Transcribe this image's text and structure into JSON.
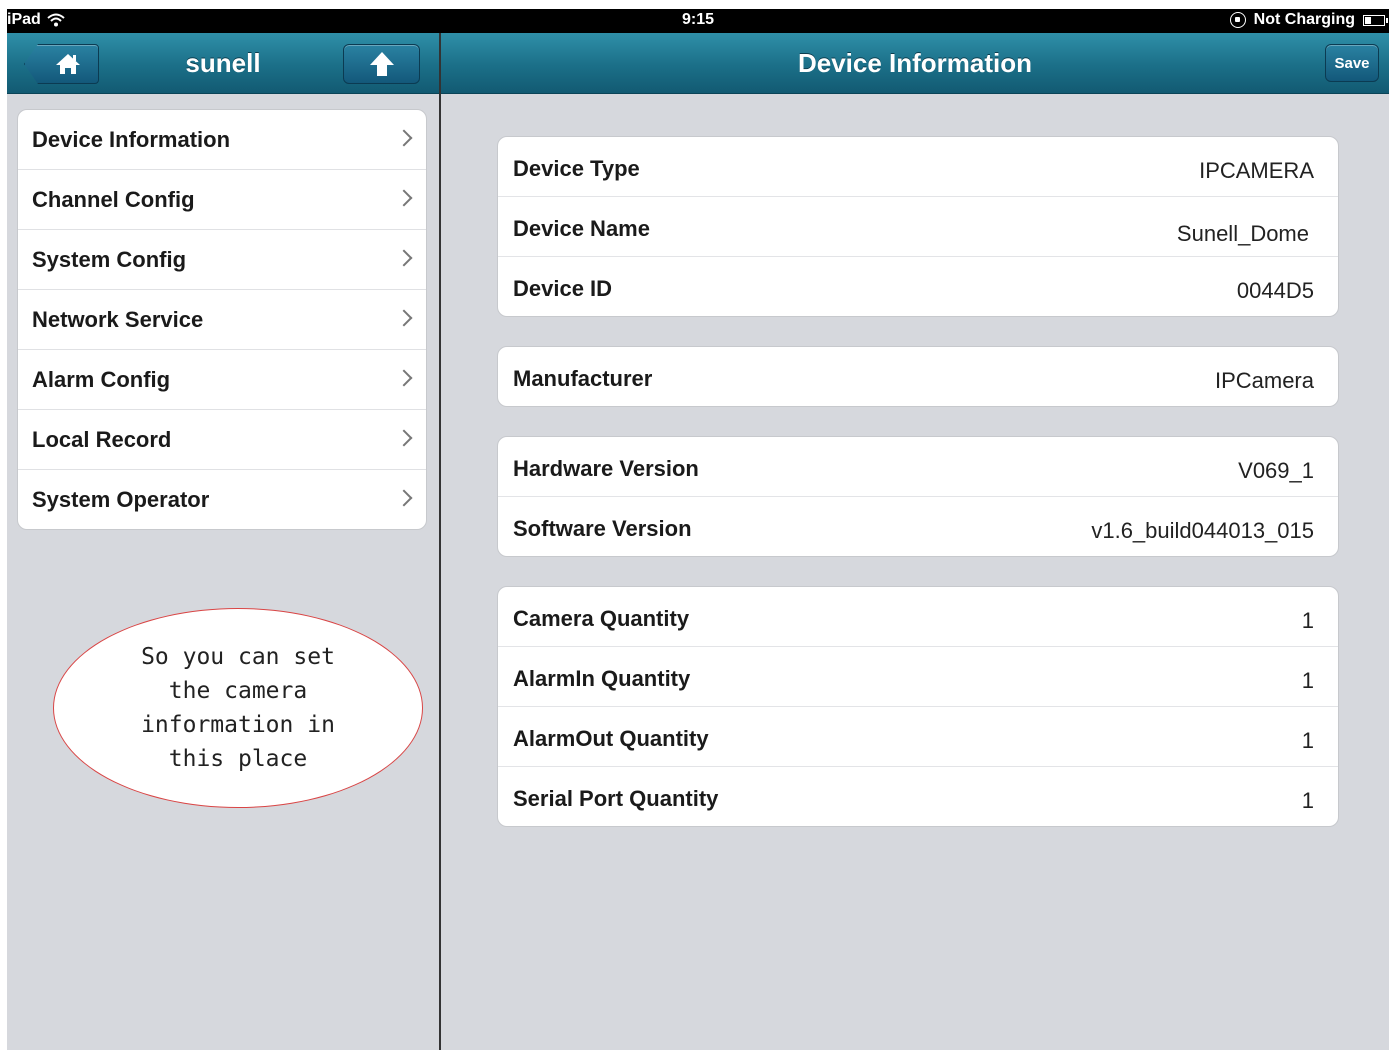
{
  "status_bar": {
    "device": "iPad",
    "time": "9:15",
    "charging": "Not Charging"
  },
  "left_nav": {
    "title": "sunell",
    "home_icon": "home-icon",
    "up_icon": "up-arrow-icon"
  },
  "right_nav": {
    "title": "Device Information",
    "save_label": "Save"
  },
  "menu": {
    "items": [
      {
        "label": "Device Information"
      },
      {
        "label": "Channel Config"
      },
      {
        "label": "System Config"
      },
      {
        "label": "Network Service"
      },
      {
        "label": "Alarm Config"
      },
      {
        "label": "Local Record"
      },
      {
        "label": "System Operator"
      }
    ]
  },
  "callout": {
    "lines": [
      "So you can set",
      "the camera",
      "information in",
      "this place"
    ]
  },
  "groups": [
    {
      "rows": [
        {
          "label": "Device Type",
          "value": "IPCAMERA"
        },
        {
          "label": "Device Name",
          "value": "Sunell_Dome"
        },
        {
          "label": "Device ID",
          "value": "0044D5"
        }
      ]
    },
    {
      "rows": [
        {
          "label": "Manufacturer",
          "value": "IPCamera"
        }
      ]
    },
    {
      "rows": [
        {
          "label": "Hardware Version",
          "value": "V069_1"
        },
        {
          "label": "Software Version",
          "value": "v1.6_build044013_015"
        }
      ]
    },
    {
      "rows": [
        {
          "label": "Camera Quantity",
          "value": "1"
        },
        {
          "label": "AlarmIn Quantity",
          "value": "1"
        },
        {
          "label": "AlarmOut Quantity",
          "value": "1"
        },
        {
          "label": "Serial Port Quantity",
          "value": "1"
        }
      ]
    }
  ],
  "colors": {
    "nav_bar": "#1b6f88",
    "background": "#d6d8dd",
    "callout_border": "#d94545"
  }
}
